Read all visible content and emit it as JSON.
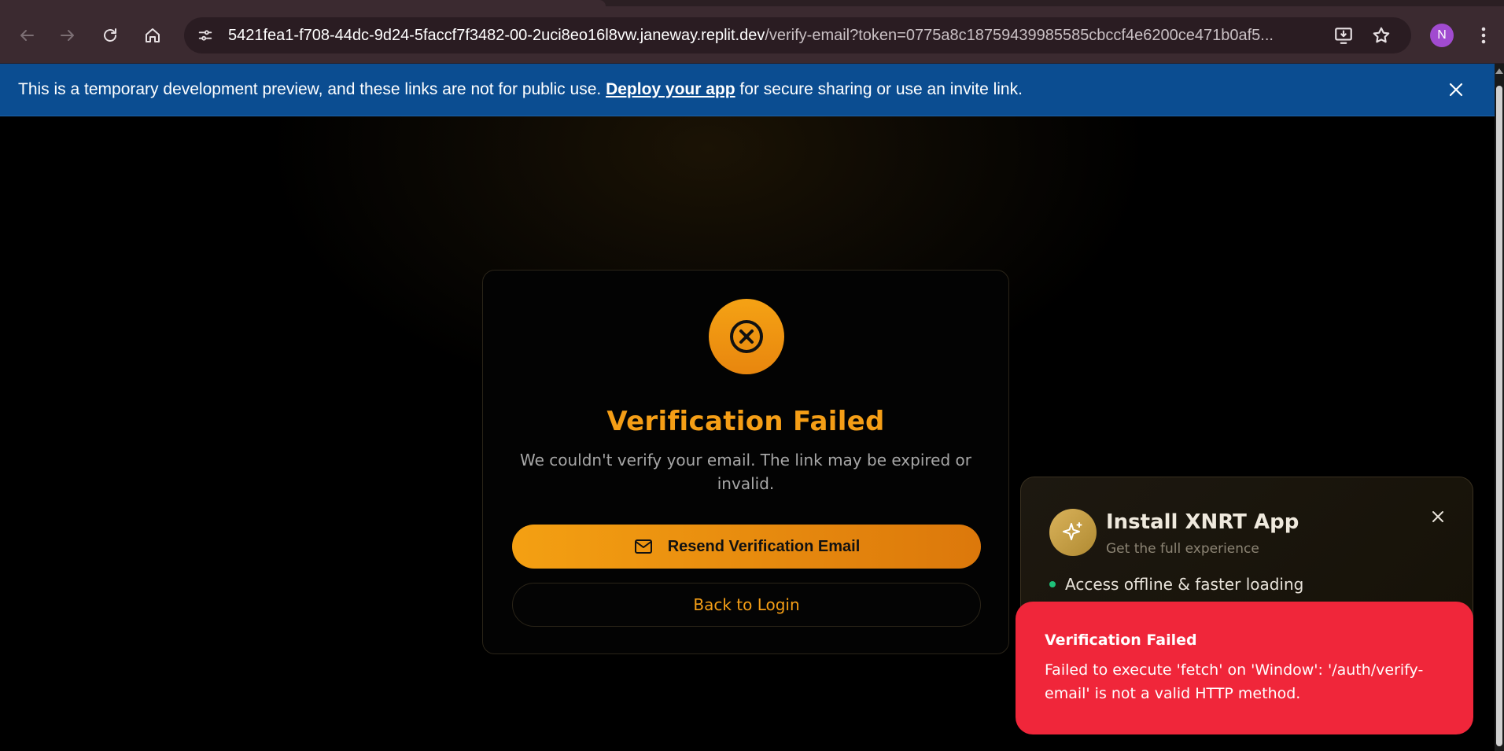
{
  "browser": {
    "url_host": "5421fea1-f708-44dc-9d24-5faccf7f3482-00-2uci8eo16l8vw.janeway.replit.dev",
    "url_path": "/verify-email?token=0775a8c18759439985585cbccf4e6200ce471b0af5...",
    "profile_initial": "N",
    "profile_color": "#a14bd0"
  },
  "banner": {
    "text_before": "This is a temporary development preview, and these links are not for public use. ",
    "link_text": "Deploy your app",
    "text_after": " for secure sharing or use an invite link."
  },
  "card": {
    "title": "Verification Failed",
    "description": "We couldn't verify your email. The link may be expired or invalid.",
    "resend_label": "Resend Verification Email",
    "back_label": "Back to Login",
    "accent": "#f59e16"
  },
  "install_prompt": {
    "title": "Install XNRT App",
    "subtitle": "Get the full experience",
    "bullet": "Access offline & faster loading"
  },
  "toast": {
    "title": "Verification Failed",
    "message": "Failed to execute 'fetch' on 'Window': '/auth/verify-email' is not a valid HTTP method.",
    "color": "#f0263a"
  },
  "icons": {
    "back": "arrow-left-icon",
    "forward": "arrow-right-icon",
    "reload": "reload-icon",
    "home": "home-icon",
    "site_info": "tune-icon",
    "install": "install-desktop-icon",
    "bookmark": "star-icon",
    "menu": "kebab-menu-icon",
    "fail": "x-circle-icon",
    "mail": "mail-icon",
    "sparkle": "sparkle-icon",
    "close": "close-icon"
  }
}
